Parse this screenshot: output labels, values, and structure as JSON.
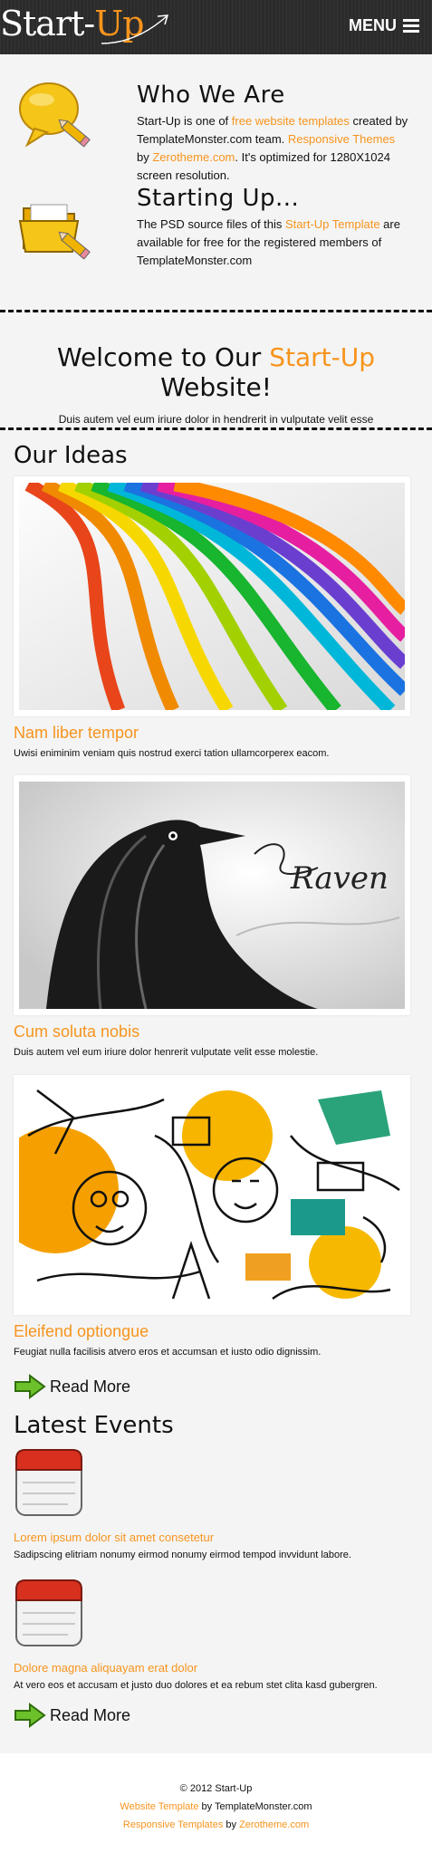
{
  "header": {
    "logo_start": "Start-",
    "logo_accent": "Up",
    "menu_label": "MENU"
  },
  "intro": {
    "who": {
      "title": "Who We Are",
      "t1": "Start-Up is one of ",
      "link1": "free website templates",
      "t2": " created by TemplateMonster.com team. ",
      "link2": "Responsive Themes",
      "t3": " by ",
      "link3": "Zerotheme.com",
      "t4": ". It's optimized for 1280X1024 screen resolution."
    },
    "starting": {
      "title": "Starting Up...",
      "t1": "The PSD source files of this ",
      "link1": "Start-Up Template",
      "t2": " are available for free for the registered members of TemplateMonster.com"
    }
  },
  "welcome": {
    "pre": "Welcome to Our ",
    "accent": "Start-Up",
    "post": " Website!",
    "sub": "Duis autem vel eum iriure dolor in hendrerit in vulputate velit esse"
  },
  "ideas": {
    "title": "Our Ideas",
    "items": [
      {
        "title": "Nam liber tempor",
        "text": "Uwisi eniminim veniam quis nostrud exerci tation ullamcorperex eacom."
      },
      {
        "title": "Cum soluta nobis",
        "text": "Duis autem vel eum iriure dolor henrerit vulputate velit esse molestie."
      },
      {
        "title": "Eleifend optiongue",
        "text": "Feugiat nulla facilisis atvero eros et accumsan et iusto odio dignissim."
      }
    ],
    "raven_caption": "Raven",
    "read_more": "Read More"
  },
  "events": {
    "title": "Latest Events",
    "items": [
      {
        "title": "Lorem ipsum dolor sit amet consetetur",
        "text": "Sadipscing elitriam nonumy eirmod nonumy eirmod tempod invvidunt labore."
      },
      {
        "title": "Dolore magna aliquayam erat dolor",
        "text": "At vero eos et accusam et justo duo dolores et ea rebum stet clita kasd gubergren."
      }
    ],
    "read_more": "Read More"
  },
  "footer": {
    "copyright": "© 2012 Start-Up",
    "l2_link": "Website Template",
    "l2_text": " by TemplateMonster.com",
    "l3_link": "Responsive Templates",
    "l3_by": " by ",
    "l3_link2": "Zerotheme.com"
  },
  "colors": {
    "accent": "#f7941d",
    "header_bg": "#2b2b2b",
    "page_bg": "#f4f4f4"
  }
}
